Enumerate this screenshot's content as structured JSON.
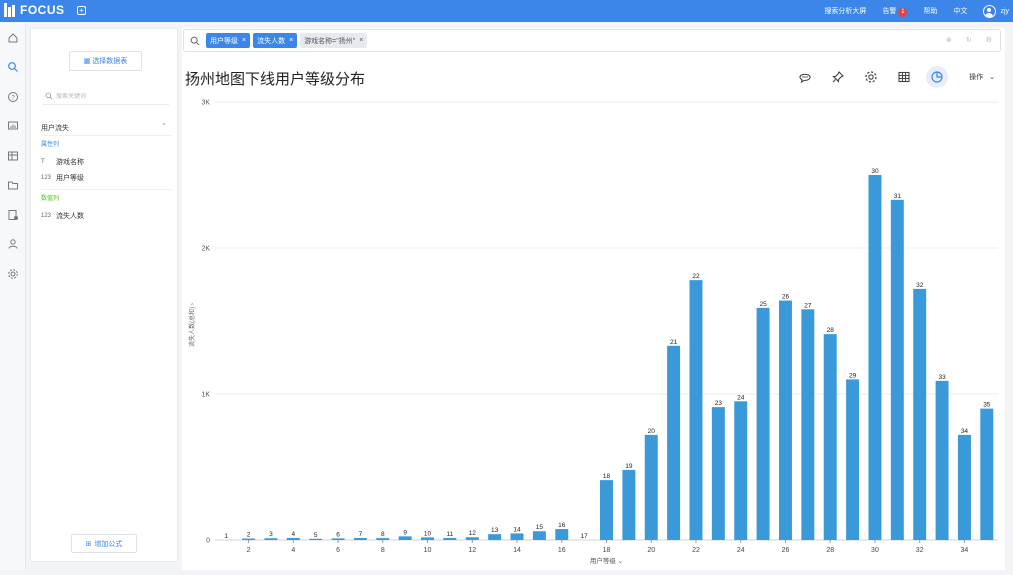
{
  "app": {
    "logo_text": "FOCUS",
    "new_tab_icon": "plus-icon"
  },
  "topnav": {
    "screen": "搜索分析大屏",
    "alert": "告警",
    "alert_count": "1",
    "help": "帮助",
    "lang": "中文",
    "user": "zjy"
  },
  "panel": {
    "select_datasource": "选择数据表",
    "search_placeholder": "搜索关键词",
    "source_name": "用户流失",
    "attr_section": "属性列",
    "attr_fields": [
      {
        "type_icon": "T",
        "label": "游戏名称"
      },
      {
        "type_icon": "123",
        "label": "用户等级"
      }
    ],
    "num_section": "数值列",
    "num_fields": [
      {
        "type_icon": "123",
        "label": "流失人数"
      }
    ],
    "add_formula": "增加公式"
  },
  "search": {
    "tokens": [
      {
        "label": "用户等级",
        "style": "blue"
      },
      {
        "label": "流失人数",
        "style": "blue"
      },
      {
        "label": "游戏名称=\"扬州\"",
        "style": "gray"
      }
    ]
  },
  "main": {
    "title": "扬州地图下线用户等级分布",
    "operation": "操作"
  },
  "colors": {
    "bar": "#3a9ad9",
    "accent": "#3b86e8"
  },
  "chart_data": {
    "type": "bar",
    "title": "扬州地图下线用户等级分布",
    "xlabel": "用户等级",
    "ylabel": "流失人数(总和)",
    "categories": [
      "1",
      "2",
      "3",
      "4",
      "5",
      "6",
      "7",
      "8",
      "9",
      "10",
      "11",
      "12",
      "13",
      "14",
      "15",
      "16",
      "17",
      "18",
      "19",
      "20",
      "21",
      "22",
      "23",
      "24",
      "25",
      "26",
      "27",
      "28",
      "29",
      "30",
      "31",
      "32",
      "33",
      "34",
      "35"
    ],
    "values": [
      0,
      10,
      12,
      14,
      8,
      11,
      14,
      13,
      25,
      18,
      14,
      19,
      40,
      45,
      60,
      75,
      0,
      410,
      480,
      720,
      1330,
      1780,
      910,
      950,
      1590,
      1640,
      1580,
      1410,
      1100,
      2500,
      2330,
      1720,
      1090,
      720,
      900
    ],
    "x_tick_labels": [
      "2",
      "4",
      "6",
      "8",
      "10",
      "12",
      "14",
      "16",
      "18",
      "20",
      "22",
      "24",
      "26",
      "28",
      "30",
      "32",
      "34"
    ],
    "y_tick_labels": [
      "0",
      "1K",
      "2K",
      "3K"
    ],
    "ylim": [
      0,
      3000
    ],
    "grid": true
  }
}
